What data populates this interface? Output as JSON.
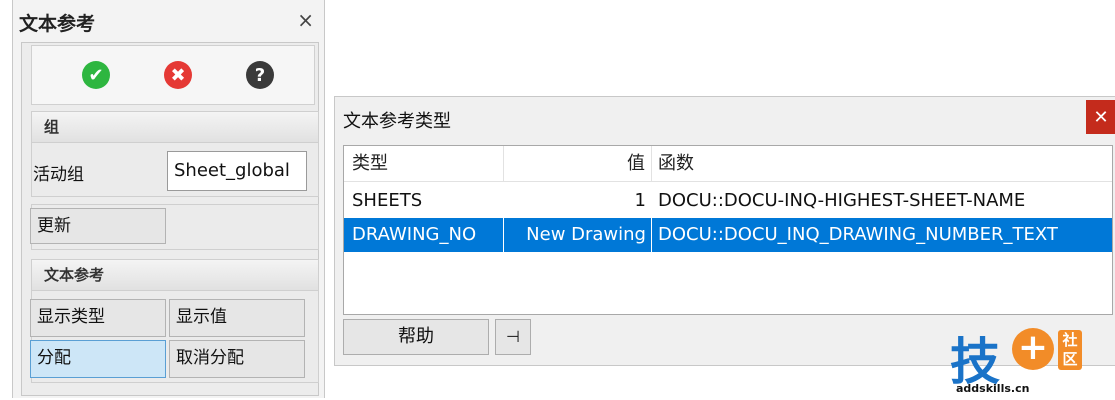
{
  "panel": {
    "title": "文本参考",
    "close_icon": "×",
    "toolbar": {
      "ok_icon": "✔",
      "cancel_icon": "✖",
      "help_icon": "?"
    },
    "group_section": {
      "header": "组",
      "active_group_label": "活动组",
      "active_group_value": "Sheet_global"
    },
    "update_button": "更新",
    "text_ref_section": {
      "header": "文本参考",
      "show_type": "显示类型",
      "show_value": "显示值",
      "assign": "分配",
      "unassign": "取消分配"
    }
  },
  "dialog": {
    "title": "文本参考类型",
    "close_icon": "✕",
    "columns": [
      "类型",
      "值",
      "函数"
    ],
    "rows": [
      {
        "type": "SHEETS",
        "value": "1",
        "function": "DOCU::DOCU-INQ-HIGHEST-SHEET-NAME"
      },
      {
        "type": "DRAWING_NO",
        "value": "New Drawing",
        "function": "DOCU::DOCU_INQ_DRAWING_NUMBER_TEXT"
      }
    ],
    "help_button": "帮助",
    "pin_icon": "⊣"
  },
  "watermark": {
    "char": "技",
    "plus": "+",
    "side_text_1": "社",
    "side_text_2": "区",
    "url": "addskills.cn"
  },
  "colors": {
    "selection": "#0078d7",
    "ok": "#2eb640",
    "cancel": "#e53935",
    "close_red": "#c42b1c"
  }
}
